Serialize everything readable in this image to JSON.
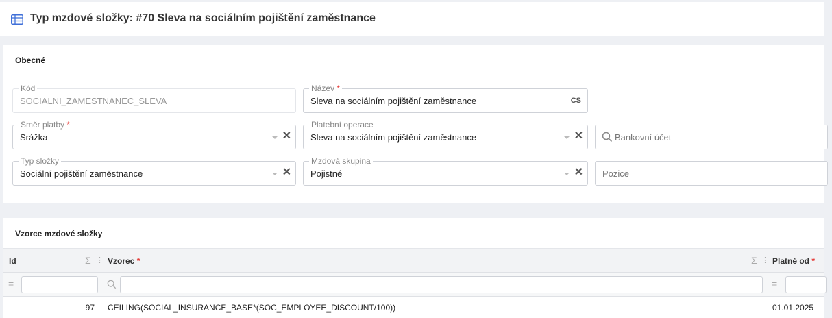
{
  "header": {
    "title": "Typ mzdové složky: #70 Sleva na sociálním pojištění zaměstnance",
    "icon": "table-icon"
  },
  "general": {
    "section_title": "Obecné",
    "kod": {
      "label": "Kód",
      "value": "SOCIALNI_ZAMESTNANEC_SLEVA"
    },
    "nazev": {
      "label": "Název",
      "required": "*",
      "value": "Sleva na sociálním pojištění zaměstnance",
      "lang": "CS"
    },
    "smer_platby": {
      "label": "Směr platby",
      "required": "*",
      "value": "Srážka"
    },
    "platebni_operace": {
      "label": "Platební operace",
      "value": "Sleva na sociálním pojištění zaměstnance"
    },
    "bankovni_ucet": {
      "placeholder": "Bankovní účet"
    },
    "typ_slozky": {
      "label": "Typ složky",
      "value": "Sociální pojištění zaměstnance"
    },
    "mzdova_skupina": {
      "label": "Mzdová skupina",
      "value": "Pojistné"
    },
    "pozice": {
      "placeholder": "Pozice"
    }
  },
  "formulas": {
    "section_title": "Vzorce mzdové složky",
    "columns": [
      {
        "label": "Id",
        "required": ""
      },
      {
        "label": "Vzorec",
        "required": "*"
      },
      {
        "label": "Platné od",
        "required": "*"
      }
    ],
    "rows": [
      {
        "id": "97",
        "formula": "CEILING(SOCIAL_INSURANCE_BASE*(SOC_EMPLOYEE_DISCOUNT/100))",
        "valid_from": "01.01.2025"
      }
    ]
  },
  "colors": {
    "required": "#e53935",
    "icon_blue": "#3f6fd8"
  }
}
